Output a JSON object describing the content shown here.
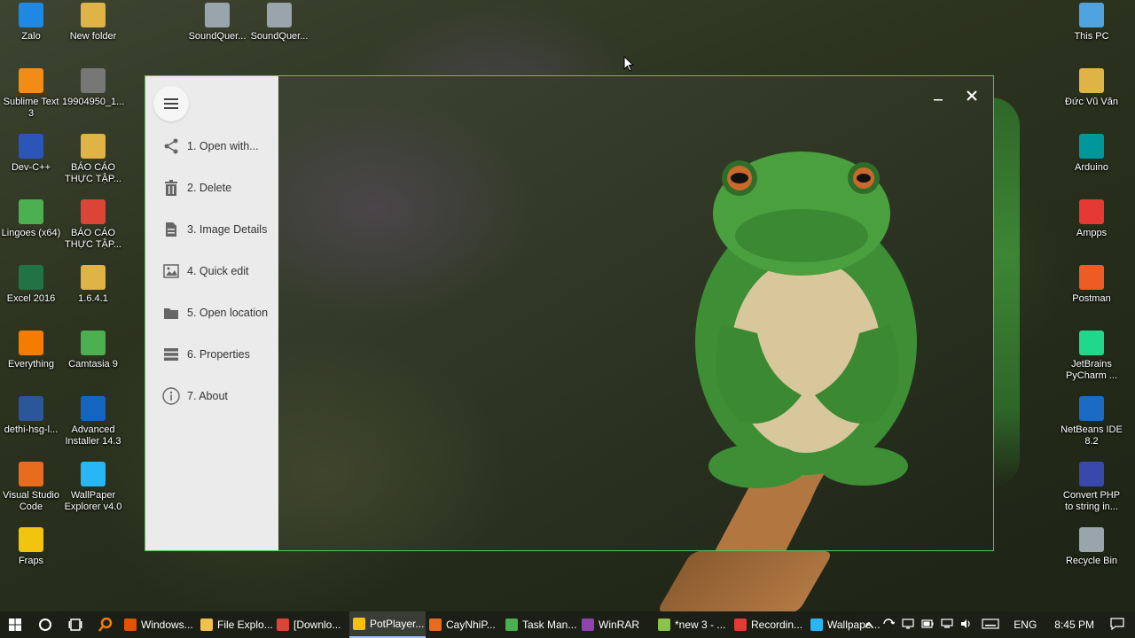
{
  "desktop_icons_left": [
    {
      "label": "Zalo",
      "icon": "zalo-icon",
      "color": "#1e88e5"
    },
    {
      "label": "New folder",
      "icon": "folder-icon",
      "color": "#e0b347"
    },
    {
      "label": "SoundQuer...",
      "icon": "soundquery-icon",
      "color": "#9aa4ad"
    },
    {
      "label": "SoundQuer...",
      "icon": "soundquery-icon",
      "color": "#9aa4ad"
    },
    {
      "label": "Sublime Text 3",
      "icon": "sublime-icon",
      "color": "#f18c16"
    },
    {
      "label": "19904950_1...",
      "icon": "image-file-icon",
      "color": "#777777"
    },
    {
      "label": "Dev-C++",
      "icon": "devcpp-icon",
      "color": "#2c55b9"
    },
    {
      "label": "BÁO CÁO THỰC TẬP...",
      "icon": "folder-icon",
      "color": "#e0b347"
    },
    {
      "label": "Lingoes (x64)",
      "icon": "lingoes-icon",
      "color": "#4caf50"
    },
    {
      "label": "BÁO CÁO THỰC TẬP...",
      "icon": "chrome-icon",
      "color": "#db4437"
    },
    {
      "label": "Excel 2016",
      "icon": "excel-icon",
      "color": "#217346"
    },
    {
      "label": "1.6.4.1",
      "icon": "folder-icon",
      "color": "#e0b347"
    },
    {
      "label": "Everything",
      "icon": "everything-icon",
      "color": "#f57c00"
    },
    {
      "label": "Camtasia 9",
      "icon": "camtasia-icon",
      "color": "#4caf50"
    },
    {
      "label": "dethi-hsg-l...",
      "icon": "word-icon",
      "color": "#2b579a"
    },
    {
      "label": "Advanced Installer 14.3",
      "icon": "advanced-installer-icon",
      "color": "#1565c0"
    },
    {
      "label": "Visual Studio Code",
      "icon": "vscode-icon",
      "color": "#e86c1f"
    },
    {
      "label": "WallPaper Explorer v4.0",
      "icon": "wallpaper-explorer-icon",
      "color": "#29b6f6"
    },
    {
      "label": "Fraps",
      "icon": "fraps-icon",
      "color": "#f1c40f"
    }
  ],
  "desktop_icons_right": [
    {
      "label": "This PC",
      "icon": "this-pc-icon",
      "color": "#4fa3e0"
    },
    {
      "label": "Đức Vũ Văn",
      "icon": "user-folder-icon",
      "color": "#e0b347"
    },
    {
      "label": "Arduino",
      "icon": "arduino-icon",
      "color": "#00979c"
    },
    {
      "label": "Ampps",
      "icon": "ampps-icon",
      "color": "#e53935"
    },
    {
      "label": "Postman",
      "icon": "postman-icon",
      "color": "#ef5b25"
    },
    {
      "label": "JetBrains PyCharm ...",
      "icon": "pycharm-icon",
      "color": "#21d789"
    },
    {
      "label": "NetBeans IDE 8.2",
      "icon": "netbeans-icon",
      "color": "#1b6ac6"
    },
    {
      "label": "Convert PHP to string in...",
      "icon": "convert-php-icon",
      "color": "#3949ab"
    },
    {
      "label": "Recycle Bin",
      "icon": "recycle-bin-icon",
      "color": "#9aa4ad"
    }
  ],
  "viewer": {
    "menu": [
      {
        "label": "1. Open with...",
        "icon": "share-icon"
      },
      {
        "label": "2. Delete",
        "icon": "trash-icon"
      },
      {
        "label": "3. Image Details",
        "icon": "document-icon"
      },
      {
        "label": "4. Quick edit",
        "icon": "picture-icon"
      },
      {
        "label": "5. Open location",
        "icon": "folder-icon"
      },
      {
        "label": "6. Properties",
        "icon": "list-icon"
      },
      {
        "label": "7. About",
        "icon": "info-icon"
      }
    ],
    "accent_border": "#5fbf5f"
  },
  "taskbar": {
    "apps": [
      {
        "label": "Windows...",
        "icon": "windows-media-icon",
        "color": "#e65100"
      },
      {
        "label": "File Explo...",
        "icon": "file-explorer-icon",
        "color": "#f0c24b"
      },
      {
        "label": "[Downlo...",
        "icon": "chrome-icon",
        "color": "#db4437"
      },
      {
        "label": "PotPlayer...",
        "icon": "potplayer-icon",
        "color": "#f4c20d",
        "active": true
      },
      {
        "label": "CayNhiP...",
        "icon": "vs-icon",
        "color": "#e86c1f"
      },
      {
        "label": "Task Man...",
        "icon": "task-manager-icon",
        "color": "#4caf50"
      },
      {
        "label": "WinRAR",
        "icon": "winrar-icon",
        "color": "#8e44ad"
      },
      {
        "label": "*new 3 - ...",
        "icon": "notepadpp-icon",
        "color": "#8bc34a"
      },
      {
        "label": "Recordin...",
        "icon": "recording-icon",
        "color": "#e53935"
      },
      {
        "label": "Wallpape...",
        "icon": "wallpaper-icon",
        "color": "#29b6f6"
      }
    ],
    "language": "ENG",
    "time": "8:45 PM"
  }
}
